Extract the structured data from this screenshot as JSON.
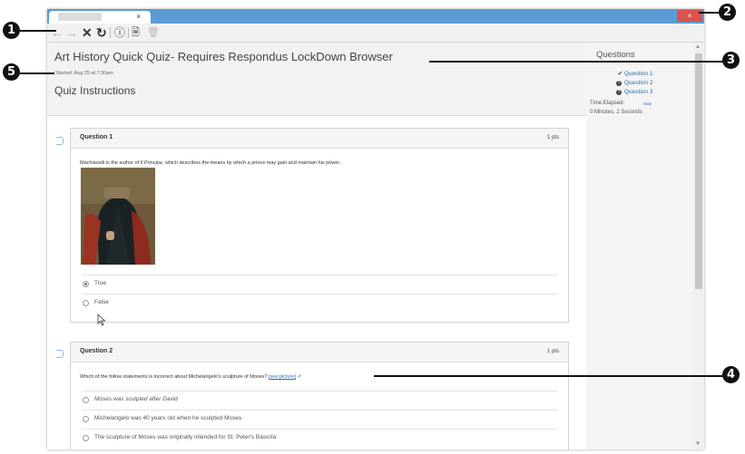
{
  "window": {
    "tab_close": "×",
    "close_glyph": "×"
  },
  "toolbar": {
    "back_glyph": "←",
    "forward_glyph": "→",
    "stop_glyph": "✕",
    "reload_glyph": "↻",
    "info_glyph": "ⓘ",
    "doc_glyph": "🗎",
    "trash_glyph": "🗑"
  },
  "quiz": {
    "title": "Art History Quick Quiz- Requires Respondus LockDown Browser",
    "started": "Started: Aug 25 at 7:30am",
    "instructions_heading": "Quiz Instructions"
  },
  "sidebar": {
    "heading": "Questions",
    "questions": [
      {
        "label": "Question 1",
        "icon": "checkmark-icon",
        "glyph": "✔"
      },
      {
        "label": "Question 2",
        "icon": "question-icon",
        "glyph": "?"
      },
      {
        "label": "Question 3",
        "icon": "question-icon",
        "glyph": "?"
      }
    ],
    "time_elapsed_label": "Time Elapsed:",
    "hide_label": "Hide",
    "time_value": "0 Minutes, 2 Seconds"
  },
  "questions": [
    {
      "title": "Question 1",
      "points": "1 pts",
      "text_before": "Machiavelli is the author of ",
      "text_italic": "Il Principe",
      "text_after": ", which describes the means by which a prince may gain and maintain his power.",
      "answers": [
        {
          "label": "True",
          "selected": true
        },
        {
          "label": "False",
          "selected": false
        }
      ]
    },
    {
      "title": "Question 2",
      "points": "1 pts",
      "text": "Which of the follow statements is incorrect about Michelangelo's sculpture of Moses?",
      "link_text": "[see picture]",
      "answers": [
        {
          "label": "Moses was sculpted after David"
        },
        {
          "label": "Michelangelo was 40 years old when he sculpted Moses"
        },
        {
          "label": "The sculpture of Moses was originally intended for St. Peter's Basicila"
        }
      ]
    }
  ],
  "callouts": [
    "1",
    "2",
    "3",
    "4",
    "5"
  ],
  "colors": {
    "titlebar": "#5b9bd5",
    "close_button": "#d9534f",
    "link": "#2a6db4",
    "header_bg": "#f2f2f2"
  }
}
